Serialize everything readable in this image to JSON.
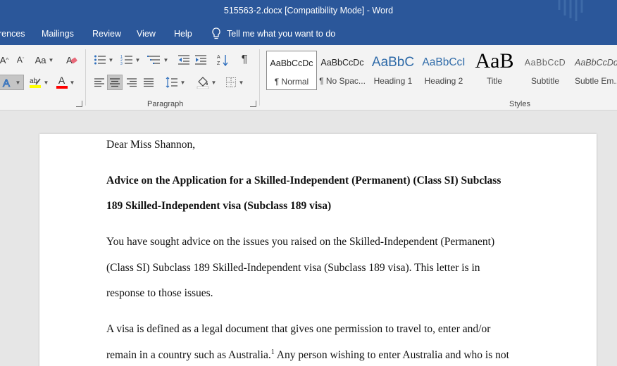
{
  "window": {
    "title": "515563-2.docx [Compatibility Mode]  -  Word"
  },
  "tabs": [
    {
      "label": "rences"
    },
    {
      "label": "Mailings"
    },
    {
      "label": "Review"
    },
    {
      "label": "View"
    },
    {
      "label": "Help"
    }
  ],
  "tell_me": {
    "label": "Tell me what you want to do"
  },
  "font_group": {
    "grow_font": "A",
    "shrink_font": "A",
    "change_case": "Aa",
    "font_color_letter": "A"
  },
  "paragraph_group": {
    "label": "Paragraph",
    "show_marks": "¶"
  },
  "styles_group": {
    "label": "Styles",
    "items": [
      {
        "preview": "AaBbCcDc",
        "name": "¶ Normal",
        "active": true
      },
      {
        "preview": "AaBbCcDc",
        "name": "¶ No Spac..."
      },
      {
        "preview": "AaBbC",
        "name": "Heading 1"
      },
      {
        "preview": "AaBbCcI",
        "name": "Heading 2"
      },
      {
        "preview": "AaB",
        "name": "Title"
      },
      {
        "preview": "AaBbCcD",
        "name": "Subtitle"
      },
      {
        "preview": "AaBbCcDd",
        "name": "Subtle Em..."
      }
    ]
  },
  "colors": {
    "word_blue": "#2b579a",
    "highlight_yellow": "#ffff00",
    "font_red": "#ff0000"
  },
  "document": {
    "salutation": "Dear Miss Shannon,",
    "heading_line1": "Advice on the Application for a Skilled-Independent (Permanent) (Class SI) Subclass",
    "heading_line2": "189 Skilled-Independent visa (Subclass 189 visa)",
    "p1_line1": "You have sought advice on the issues you raised on the Skilled-Independent (Permanent)",
    "p1_line2": "(Class SI) Subclass 189 Skilled-Independent visa (Subclass 189 visa). This letter is in",
    "p1_line3": "response to those issues.",
    "p2_line1": "A visa is defined as a legal document that gives one permission to travel to, enter and/or",
    "p2_line2a": "remain in a country such as Australia.",
    "p2_footnote": "1",
    "p2_line2b": " Any person wishing to enter Australia and who is not"
  }
}
